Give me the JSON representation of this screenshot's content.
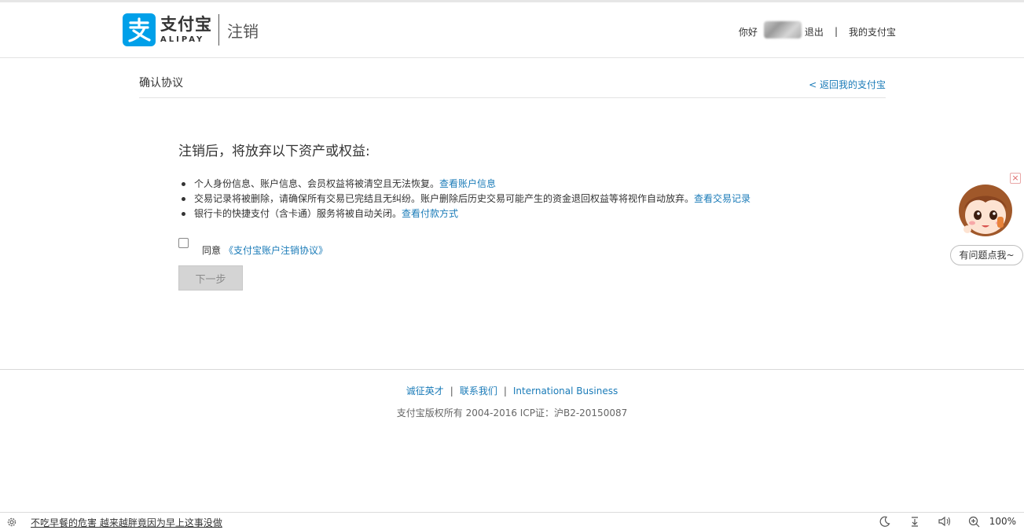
{
  "header": {
    "logo_cn": "支付宝",
    "logo_en": "ALIPAY",
    "page_name": "注销",
    "greeting": "你好",
    "logout": "退出",
    "divider": "|",
    "my_alipay": "我的支付宝"
  },
  "section": {
    "title": "确认协议",
    "back_link": "< 返回我的支付宝"
  },
  "content": {
    "title": "注销后，将放弃以下资产或权益:",
    "items": [
      {
        "text": "个人身份信息、账户信息、会员权益将被清空且无法恢复。",
        "link": "查看账户信息"
      },
      {
        "text": "交易记录将被删除，请确保所有交易已完结且无纠纷。账户删除后历史交易可能产生的资金退回权益等将视作自动放弃。",
        "link": "查看交易记录"
      },
      {
        "text": "银行卡的快捷支付（含卡通）服务将被自动关闭。",
        "link": "查看付款方式"
      }
    ],
    "agree_label": "同意",
    "agree_link": "《支付宝账户注销协议》",
    "agree_checked": false,
    "next_button": "下一步"
  },
  "helper": {
    "bubble": "有问题点我~",
    "close": "×"
  },
  "footer": {
    "links": [
      "诚征英才",
      "联系我们",
      "International Business"
    ],
    "separator": "|",
    "copyright": "支付宝版权所有 2004-2016 ICP证：沪B2-20150087"
  },
  "statusbar": {
    "news": "不吃早餐的危害 越来越胖竟因为早上这事没做",
    "zoom": "100%"
  },
  "colors": {
    "brand": "#00a0e9",
    "link": "#1a7bb8",
    "disabled_button": "#d4d4d4"
  }
}
